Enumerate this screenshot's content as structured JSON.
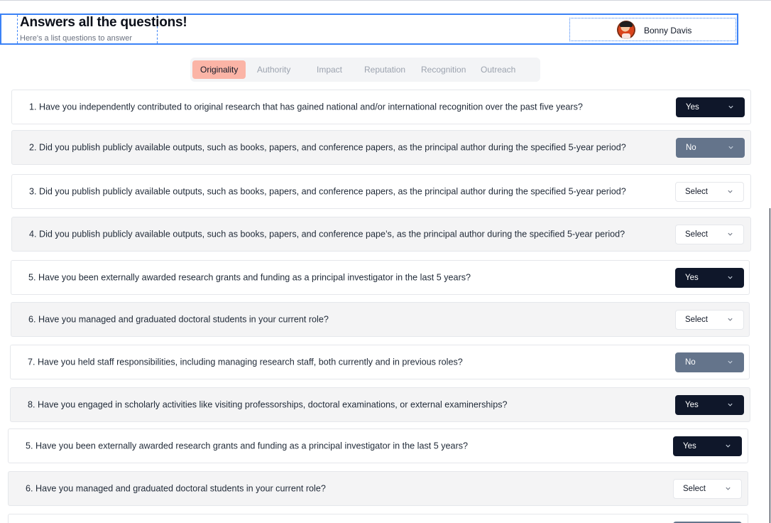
{
  "header": {
    "title": "Answers all the questions!",
    "subtitle": "Here's a list questions to answer",
    "user_name": "Bonny Davis"
  },
  "tabs": [
    {
      "label": "Originality",
      "active": true
    },
    {
      "label": "Authority",
      "active": false
    },
    {
      "label": "Impact",
      "active": false
    },
    {
      "label": "Reputation",
      "active": false
    },
    {
      "label": "Recognition",
      "active": false
    },
    {
      "label": "Outreach",
      "active": false
    }
  ],
  "questions": [
    {
      "text": "1. Have you independently contributed to original research that has gained national and/or international recognition over the past five years?",
      "answer": "Yes"
    },
    {
      "text": "2. Did you publish publicly available outputs, such as books, papers, and conference papers, as the principal author during the specified 5-year period?",
      "answer": "No"
    },
    {
      "text": "3. Did you publish publicly available outputs, such as books, papers, and conference papers, as the principal author during the specified 5-year period?",
      "answer": "Select"
    },
    {
      "text": "4. Did you publish publicly available outputs, such as books, papers, and conference pape’s, as the principal author during the specified 5-year period?",
      "answer": "Select"
    },
    {
      "text": "5. Have you been externally awarded research grants and funding as a principal investigator in the last 5 years?",
      "answer": "Yes"
    },
    {
      "text": "6. Have you managed and graduated doctoral students in your current role?",
      "answer": "Select"
    },
    {
      "text": "7. Have you held staff responsibilities, including managing research staff, both currently and in previous roles?",
      "answer": "No"
    },
    {
      "text": "8. Have you engaged in scholarly activities like visiting professorships, doctoral examinations, or external examinerships?",
      "answer": "Yes"
    },
    {
      "text": "5. Have you been externally awarded research grants and funding as a principal investigator in the last 5 years?",
      "answer": "Yes"
    },
    {
      "text": "6. Have you managed and graduated doctoral students in your current role?",
      "answer": "Select"
    },
    {
      "text": "",
      "answer": ""
    }
  ],
  "colors": {
    "yes": "#0f172a",
    "no": "#64748b",
    "active_tab": "#fbb4a6",
    "highlight": "#3b82f6"
  }
}
